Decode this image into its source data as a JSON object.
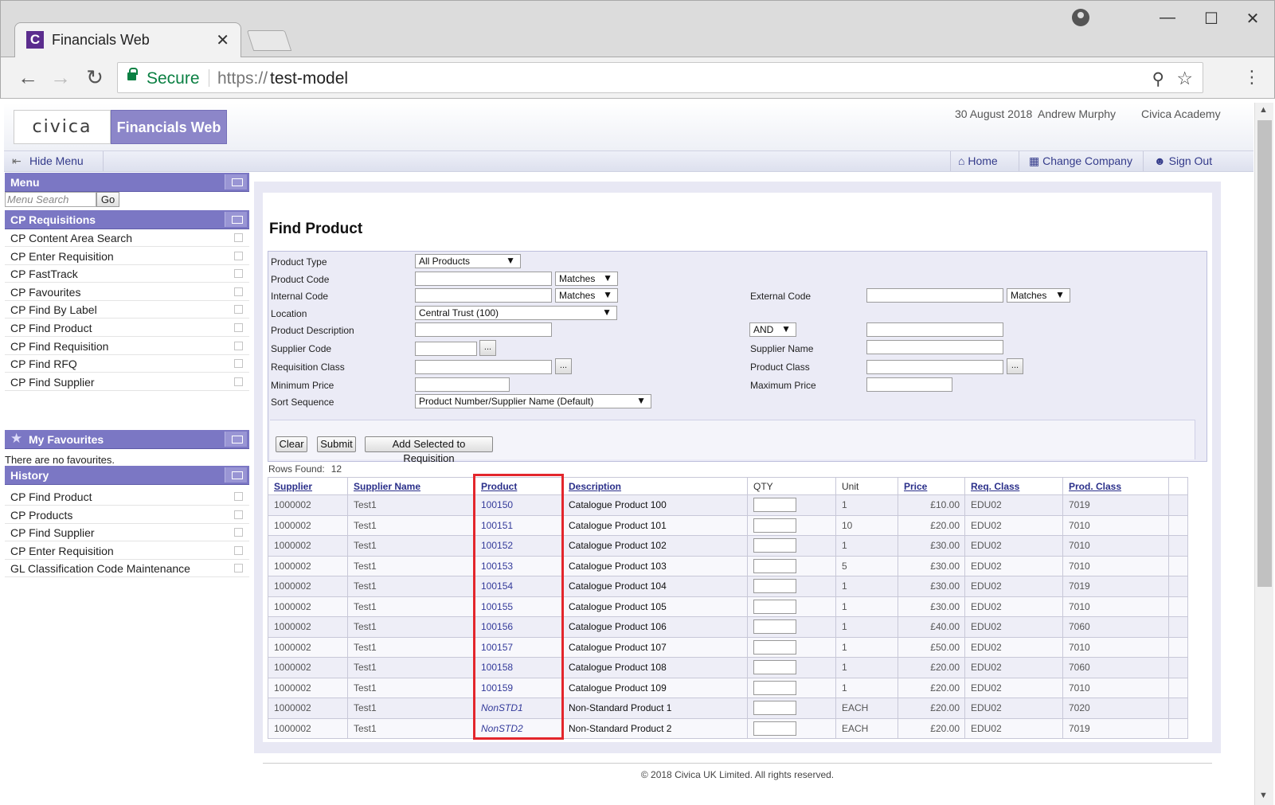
{
  "browser": {
    "tab_title": "Financials Web",
    "tab_close": "✕",
    "secure_label": "Secure",
    "url_protocol": "https://",
    "url_host": "test-model"
  },
  "header": {
    "logo_text": "civica",
    "app_name": "Financials Web",
    "date": "30 August 2018",
    "user": "Andrew Murphy",
    "company": "Civica Academy"
  },
  "nav": {
    "hide_menu": "Hide Menu",
    "home": "Home",
    "change_company": "Change Company",
    "sign_out": "Sign Out"
  },
  "sidebar": {
    "menu_title": "Menu",
    "search_placeholder": "Menu Search",
    "go": "Go",
    "requisitions_title": "CP Requisitions",
    "requisitions": [
      "CP Content Area Search",
      "CP Enter Requisition",
      "CP FastTrack",
      "CP Favourites",
      "CP Find By Label",
      "CP Find Product",
      "CP Find Requisition",
      "CP Find RFQ",
      "CP Find Supplier"
    ],
    "favourites_title": "My Favourites",
    "no_favourites": "There are no favourites.",
    "history_title": "History",
    "history": [
      "CP Find Product",
      "CP Products",
      "CP Find Supplier",
      "CP Enter Requisition",
      "GL Classification Code Maintenance"
    ]
  },
  "form": {
    "title": "Find Product",
    "labels": {
      "product_type": "Product Type",
      "product_code": "Product Code",
      "internal_code": "Internal Code",
      "external_code": "External Code",
      "location": "Location",
      "product_description": "Product Description",
      "supplier_code": "Supplier Code",
      "supplier_name": "Supplier Name",
      "requisition_class": "Requisition Class",
      "product_class": "Product Class",
      "minimum_price": "Minimum Price",
      "maximum_price": "Maximum Price",
      "sort_sequence": "Sort Sequence"
    },
    "values": {
      "product_type": "All Products",
      "product_code_match": "Matches",
      "internal_code_match": "Matches",
      "external_code_match": "Matches",
      "location": "Central Trust (100)",
      "description_op": "AND",
      "sort_sequence": "Product Number/Supplier Name (Default)"
    },
    "lookup": "...",
    "buttons": {
      "clear": "Clear",
      "submit": "Submit",
      "add_selected": "Add Selected to Requisition"
    }
  },
  "results": {
    "rows_found_label": "Rows Found:",
    "rows_found": "12",
    "columns": [
      "Supplier",
      "Supplier Name",
      "Product",
      "Description",
      "QTY",
      "Unit",
      "Price",
      "Req. Class",
      "Prod. Class"
    ],
    "rows": [
      {
        "supplier": "1000002",
        "supplier_name": "Test1",
        "product": "100150",
        "description": "Catalogue Product 100",
        "unit": "1",
        "price": "£10.00",
        "req_class": "EDU02",
        "prod_class": "7019"
      },
      {
        "supplier": "1000002",
        "supplier_name": "Test1",
        "product": "100151",
        "description": "Catalogue Product 101",
        "unit": "10",
        "price": "£20.00",
        "req_class": "EDU02",
        "prod_class": "7010"
      },
      {
        "supplier": "1000002",
        "supplier_name": "Test1",
        "product": "100152",
        "description": "Catalogue Product 102",
        "unit": "1",
        "price": "£30.00",
        "req_class": "EDU02",
        "prod_class": "7010"
      },
      {
        "supplier": "1000002",
        "supplier_name": "Test1",
        "product": "100153",
        "description": "Catalogue Product 103",
        "unit": "5",
        "price": "£30.00",
        "req_class": "EDU02",
        "prod_class": "7010"
      },
      {
        "supplier": "1000002",
        "supplier_name": "Test1",
        "product": "100154",
        "description": "Catalogue Product 104",
        "unit": "1",
        "price": "£30.00",
        "req_class": "EDU02",
        "prod_class": "7019"
      },
      {
        "supplier": "1000002",
        "supplier_name": "Test1",
        "product": "100155",
        "description": "Catalogue Product 105",
        "unit": "1",
        "price": "£30.00",
        "req_class": "EDU02",
        "prod_class": "7010"
      },
      {
        "supplier": "1000002",
        "supplier_name": "Test1",
        "product": "100156",
        "description": "Catalogue Product 106",
        "unit": "1",
        "price": "£40.00",
        "req_class": "EDU02",
        "prod_class": "7060"
      },
      {
        "supplier": "1000002",
        "supplier_name": "Test1",
        "product": "100157",
        "description": "Catalogue Product 107",
        "unit": "1",
        "price": "£50.00",
        "req_class": "EDU02",
        "prod_class": "7010"
      },
      {
        "supplier": "1000002",
        "supplier_name": "Test1",
        "product": "100158",
        "description": "Catalogue Product 108",
        "unit": "1",
        "price": "£20.00",
        "req_class": "EDU02",
        "prod_class": "7060"
      },
      {
        "supplier": "1000002",
        "supplier_name": "Test1",
        "product": "100159",
        "description": "Catalogue Product 109",
        "unit": "1",
        "price": "£20.00",
        "req_class": "EDU02",
        "prod_class": "7010"
      },
      {
        "supplier": "1000002",
        "supplier_name": "Test1",
        "product": "NonSTD1",
        "description": "Non-Standard Product 1",
        "unit": "EACH",
        "price": "£20.00",
        "req_class": "EDU02",
        "prod_class": "7020"
      },
      {
        "supplier": "1000002",
        "supplier_name": "Test1",
        "product": "NonSTD2",
        "description": "Non-Standard Product 2",
        "unit": "EACH",
        "price": "£20.00",
        "req_class": "EDU02",
        "prod_class": "7019"
      }
    ]
  },
  "footer": "© 2018 Civica UK Limited. All rights reserved.",
  "colors": {
    "accent": "#7b77c4",
    "highlight": "#e3262c",
    "link": "#2a2f8a"
  }
}
